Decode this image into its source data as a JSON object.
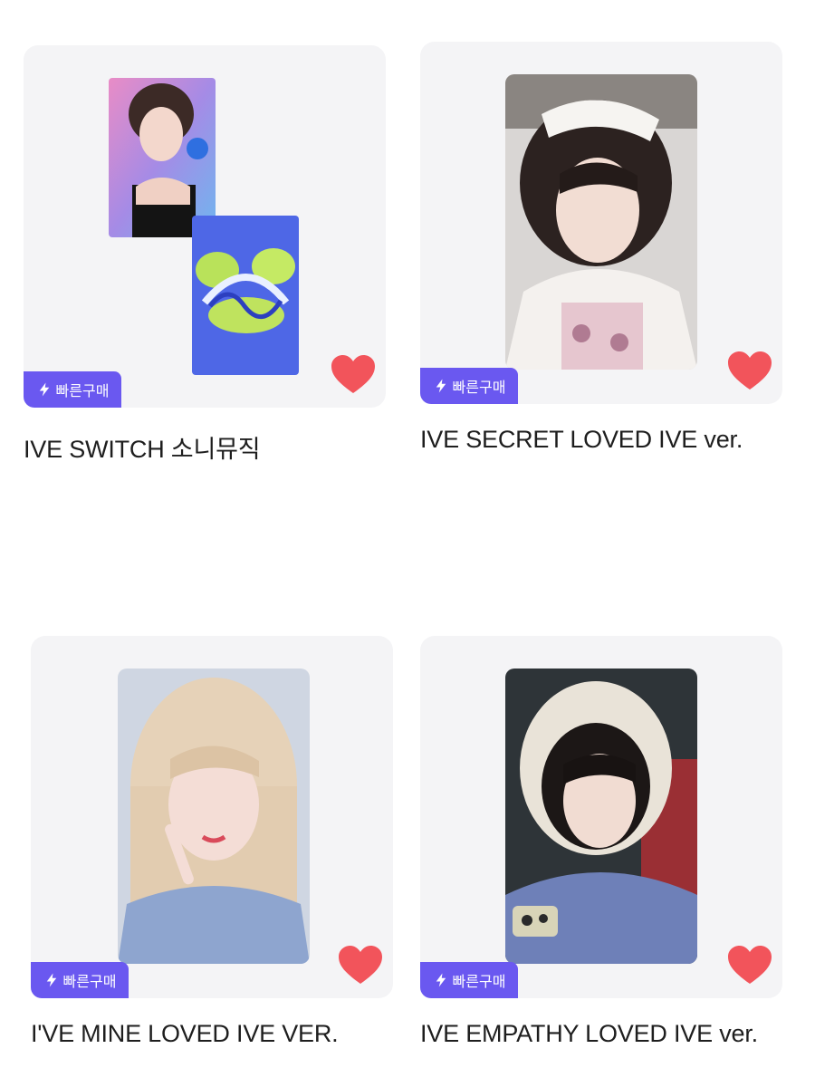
{
  "products": [
    {
      "title": "IVE SWITCH 소니뮤직",
      "badge": "빠른구매",
      "photo": "photocard-switch-album"
    },
    {
      "title": "IVE SECRET LOVED IVE ver.",
      "badge": "빠른구매",
      "photo": "photocard-headband"
    },
    {
      "title": "I'VE MINE LOVED IVE VER.",
      "badge": "빠른구매",
      "photo": "photocard-blonde"
    },
    {
      "title": "IVE EMPATHY LOVED IVE ver.",
      "badge": "빠른구매",
      "photo": "photocard-knit-hood"
    }
  ],
  "colors": {
    "badge": "#6a58f0",
    "heart": "#f2545b",
    "card": "#f4f4f6"
  },
  "icons": {
    "badge": "lightning-icon",
    "favorite": "heart-icon"
  }
}
